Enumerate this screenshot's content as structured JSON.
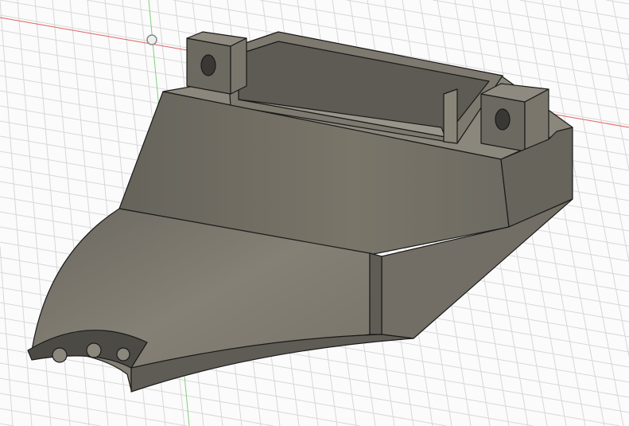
{
  "viewport": {
    "background_color": "#fbfbfb",
    "grid_color": "#d6d6d6",
    "x_axis_color": "#e06060",
    "y_axis_color": "#7ed07e",
    "model_color": "#6f6c64",
    "edge_color": "#1a1a1a"
  }
}
